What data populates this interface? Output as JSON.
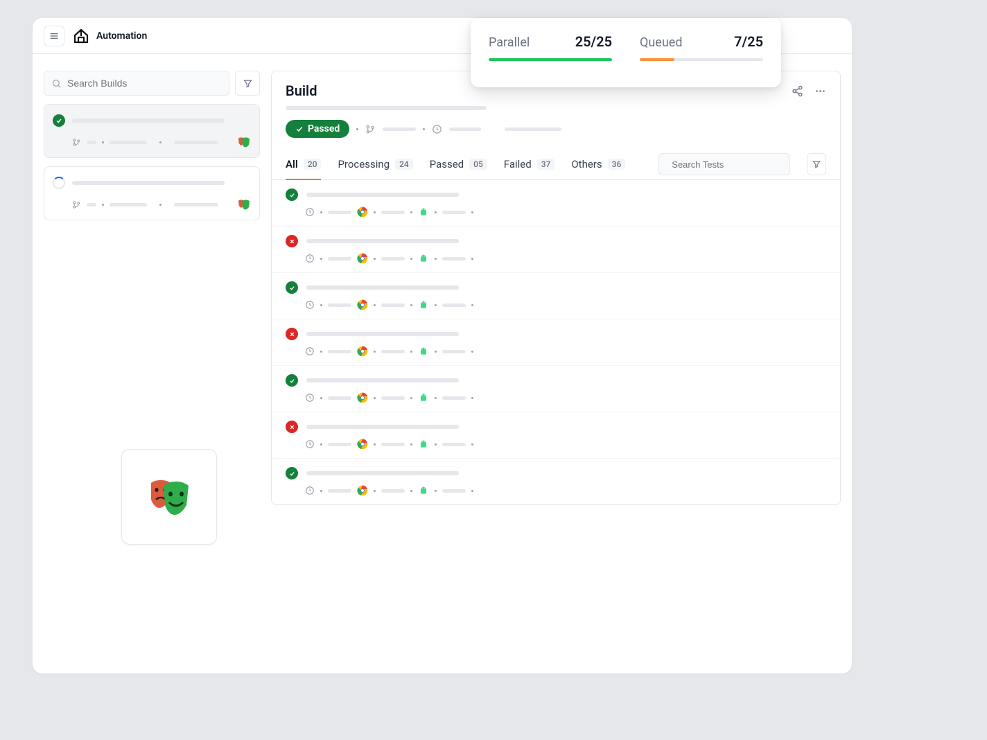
{
  "app": {
    "title": "Automation"
  },
  "stats": {
    "parallel": {
      "label": "Parallel",
      "value": "25/25",
      "percent": 100,
      "color": "#22c55e"
    },
    "queued": {
      "label": "Queued",
      "value": "7/25",
      "percent": 28,
      "color": "#fb923c"
    }
  },
  "sidebar": {
    "search_placeholder": "Search Builds",
    "builds": [
      {
        "status": "passed"
      },
      {
        "status": "running"
      }
    ]
  },
  "build": {
    "title": "Build",
    "status_label": "Passed"
  },
  "tabs": [
    {
      "label": "All",
      "count": "20",
      "active": true
    },
    {
      "label": "Processing",
      "count": "24",
      "active": false
    },
    {
      "label": "Passed",
      "count": "05",
      "active": false
    },
    {
      "label": "Failed",
      "count": "37",
      "active": false
    },
    {
      "label": "Others",
      "count": "36",
      "active": false
    }
  ],
  "tests_search_placeholder": "Search Tests",
  "tests": [
    {
      "status": "passed"
    },
    {
      "status": "failed"
    },
    {
      "status": "passed"
    },
    {
      "status": "failed"
    },
    {
      "status": "passed"
    },
    {
      "status": "failed"
    },
    {
      "status": "passed"
    }
  ]
}
